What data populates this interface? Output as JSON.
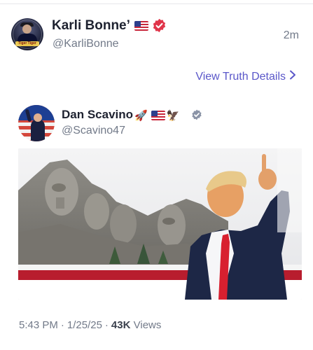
{
  "post": {
    "author_name": "Karli Bonne’",
    "author_handle": "@KarliBonne",
    "timestamp": "2m",
    "view_details_label": "View Truth Details",
    "avatar_text": "Tiger Tiger"
  },
  "quoted": {
    "author_name": "Dan Scavino",
    "author_handle": "@Scavino47",
    "name_emojis": [
      "🚀",
      "🦅"
    ]
  },
  "meta": {
    "time": "5:43 PM",
    "separator": "·",
    "date": "1/25/25",
    "views_count": "43K",
    "views_label": "Views"
  },
  "icons": {
    "flag": "us-flag-icon",
    "verified_outer": "verified-badge-red-icon",
    "verified_inner": "verified-badge-grey-icon",
    "chevron": "chevron-right-icon"
  },
  "colors": {
    "link": "#5a57c9",
    "verified_outer": "#e0354a",
    "verified_inner": "#8a93a6",
    "secondary_text": "#727a89"
  }
}
